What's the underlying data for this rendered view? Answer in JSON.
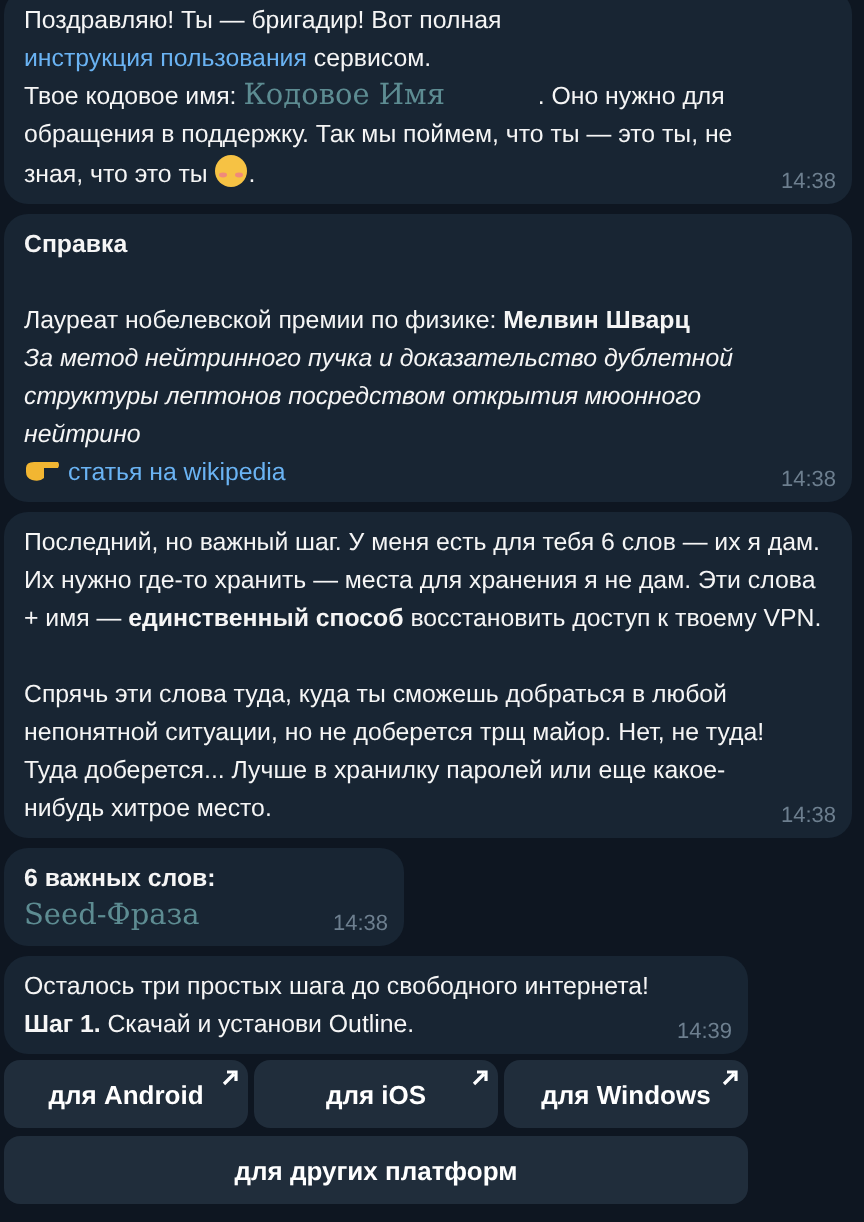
{
  "messages": [
    {
      "paragraphs": [
        [
          [
            {
              "kind": "text",
              "text": "Поздравляю! Ты — бригадир! Вот полная "
            },
            {
              "kind": "link",
              "text": "инструкция пользования"
            },
            {
              "kind": "text",
              "text": " сервисом."
            }
          ],
          [
            {
              "kind": "text",
              "text": "Твое кодовое имя: "
            },
            {
              "kind": "codename",
              "text": "Кодовое Имя"
            },
            {
              "kind": "text",
              "text": ". Оно нужно для обращения в поддержку. Так мы поймем, что ты — это ты, не зная, что это ты "
            },
            {
              "kind": "emoji"
            },
            {
              "kind": "text",
              "text": "."
            }
          ]
        ]
      ],
      "time": "14:38"
    },
    {
      "paragraphs": [
        [
          [
            {
              "kind": "bold",
              "text": "Справка"
            }
          ]
        ],
        [
          [
            {
              "kind": "text",
              "text": "Лауреат нобелевской премии по физике: **Мелвин Шварц**"
            }
          ],
          [
            {
              "kind": "italic",
              "text": "За метод нейтринного пучка и доказательство дублетной структуры лептонов посредством открытия мюонного нейтрино"
            }
          ],
          [
            {
              "kind": "pointer"
            },
            {
              "kind": "link",
              "text": "статья на wikipedia"
            }
          ]
        ]
      ],
      "time": "14:38"
    },
    {
      "paragraphs": [
        [
          [
            {
              "kind": "text",
              "text": "Последний, но важный шаг. У меня есть для тебя 6 слов — их я дам. Их нужно где-то хранить — места для хранения я не дам. Эти слова + имя — **единственный способ** восстановить доступ к твоему VPN."
            }
          ]
        ],
        [
          [
            {
              "kind": "text",
              "text": "Спрячь эти слова туда, куда ты сможешь добраться в любой непонятной ситуации, но не доберется трщ майор. Нет, не туда! Туда доберется... Лучше в хранилку паролей или еще какое-нибудь хитрое место."
            }
          ]
        ]
      ],
      "time": "14:38"
    },
    {
      "paragraphs": [
        [
          [
            {
              "kind": "bold",
              "text": "6 важных слов:"
            }
          ],
          [
            {
              "kind": "codename",
              "text": "Seed-Фраза"
            }
          ]
        ]
      ],
      "time": "14:38"
    },
    {
      "paragraphs": [
        [
          [
            {
              "kind": "text",
              "text": "Осталось три простых шага до свободного интернета!"
            }
          ],
          [
            {
              "kind": "text",
              "text": "**Шаг 1.** Скачай и установи Outline."
            }
          ]
        ]
      ],
      "time": "14:39",
      "buttons": [
        [
          {
            "label": "для Android",
            "external": true
          },
          {
            "label": "для iOS",
            "external": true
          },
          {
            "label": "для Windows",
            "external": true
          }
        ],
        [
          {
            "label": "для других платформ",
            "external": false
          }
        ]
      ]
    }
  ]
}
